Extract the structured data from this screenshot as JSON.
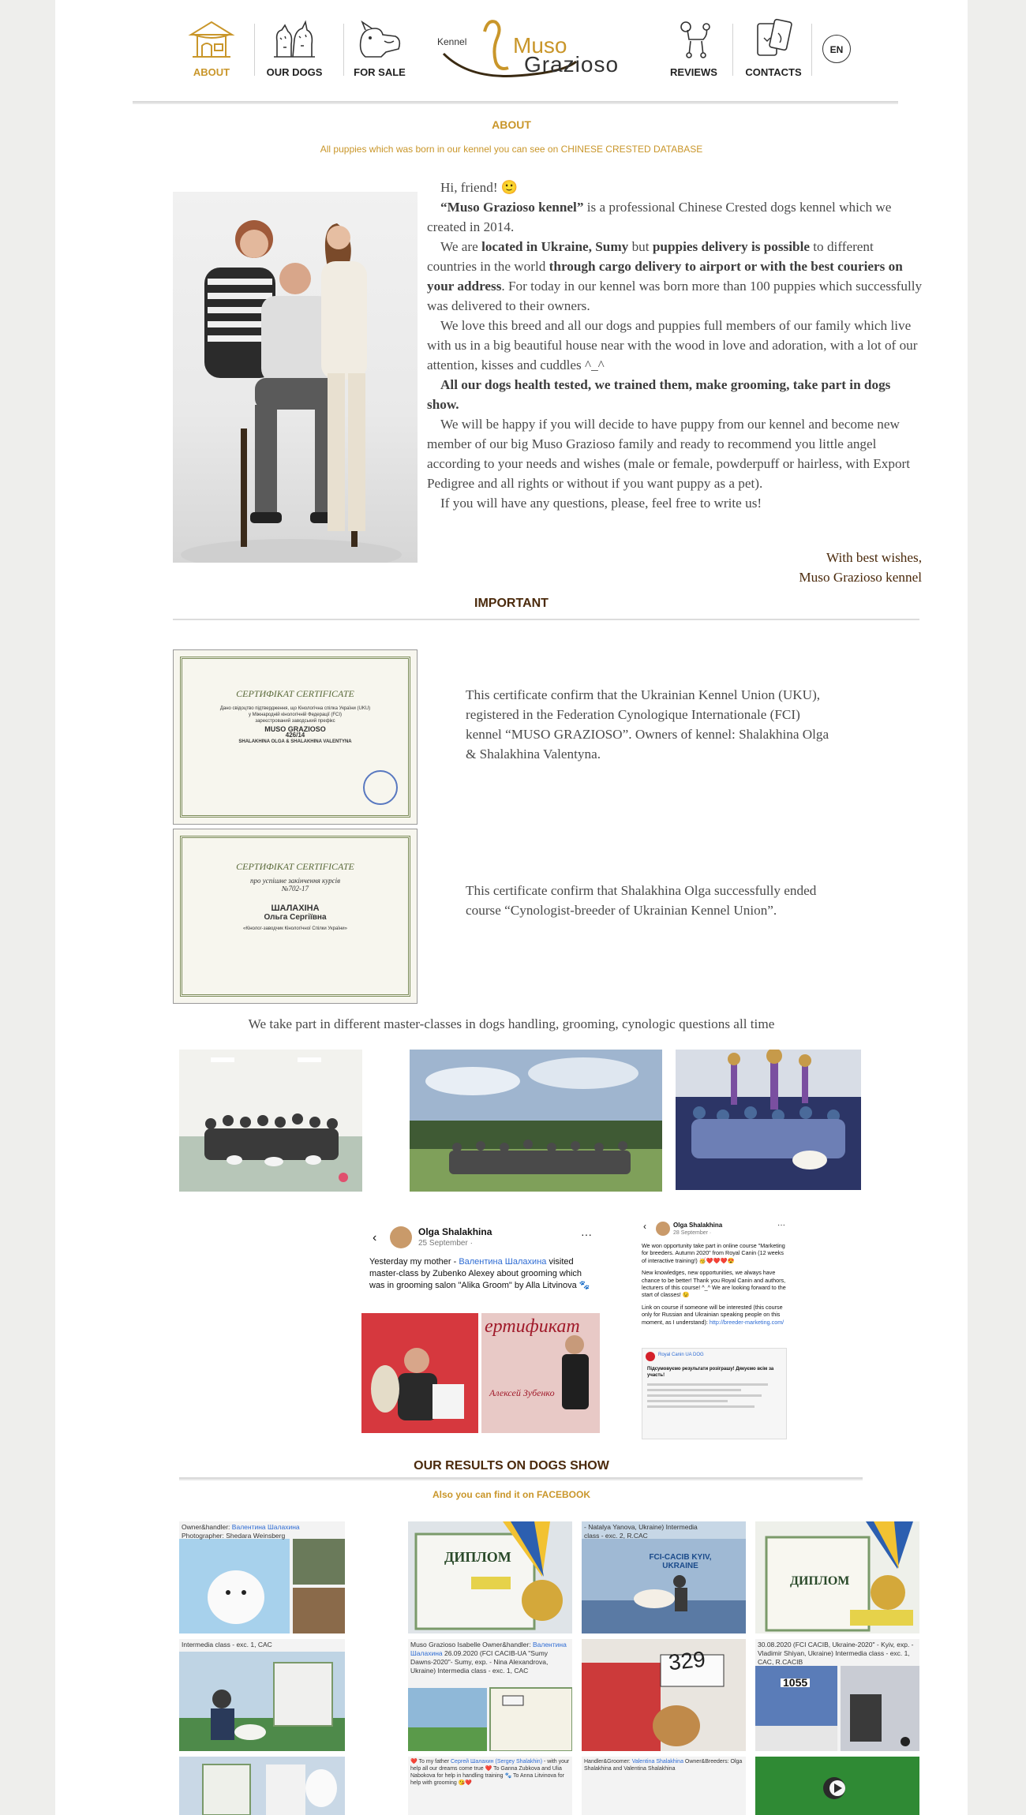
{
  "nav": {
    "about": "ABOUT",
    "our_dogs": "OUR DOGS",
    "for_sale": "FOR SALE",
    "reviews": "REVIEWS",
    "contacts": "CONTACTS",
    "lang": "EN"
  },
  "logo": {
    "kennel": "Kennel",
    "muso": "Muso",
    "grazioso": "Grazioso"
  },
  "about": {
    "title": "ABOUT",
    "subtitle": "All puppies which was born in our kennel you can see on CHINESE CRESTED DATABASE",
    "greeting": "Hi, friend! 🙂",
    "p1_bold": "“Muso Grazioso kennel”",
    "p1_rest": " is a professional Chinese Crested dogs kennel which we created in 2014.",
    "p2_a": "We are ",
    "p2_b": "located in Ukraine, Sumy",
    "p2_c": " but ",
    "p2_d": "puppies delivery is possible",
    "p2_e": " to different countries in the world ",
    "p2_f": "through cargo delivery to airport or with the best couriers on your address",
    "p2_g": ". For today in our kennel was born more than 100 puppies which successfully was delivered to their owners.",
    "p3": "We love this breed and all our dogs and puppies full members of our family which live with us in a big beautiful house near with the wood in love and adoration, with a lot of our attention, kisses and cuddles ^_^",
    "p4": "All our dogs health tested, we trained them, make grooming, take part in dogs show.",
    "p5": "We will be happy if you will decide to have puppy from our kennel and become new member of our big Muso Grazioso family and ready to recommend you little angel according to your needs and wishes (male or female, powderpuff or hairless, with Export Pedigree and all rights or without if you want puppy as a pet).",
    "p6": "If you will have any questions, please, feel free to write us!",
    "sign1": "With best wishes,",
    "sign2": "Muso Grazioso kennel"
  },
  "important": {
    "title": "IMPORTANT",
    "cert1_text": "This certificate confirm that the Ukrainian Kennel Union (UKU), registered in the Federation Cynologique Internationale (FCI) kennel “MUSO GRAZIOSO”. Owners of kennel: Shalakhina Olga & Shalakhina Valentyna.",
    "cert2_text": "This certificate confirm that Shalakhina Olga successfully ended course “Cynologist-breeder of Ukrainian Kennel Union”.",
    "cert1": {
      "title_ua": "СЕРТИФІКАТ CERTIFICATE",
      "line1": "Дано свідоцтво підтвердження, що Кінологічна спілка України (UKU)",
      "line2": "у Міжнародній кінологічній Федерації (FCI)",
      "line3": "зареєстрований заводський префікс",
      "name": "MUSO GRAZIOSO",
      "num": "426/14",
      "owners": "SHALAKHINA OLGA & SHALAKHINA VALENTYNA"
    },
    "cert2": {
      "title_ua": "СЕРТИФІКАТ CERTIFICATE",
      "line1": "про успішне закінчення курсів",
      "num": "№702-17",
      "name": "ШАЛАХІНА",
      "name2": "Ольга Сергіївна",
      "course": "«Кінолог-заводчик Кінологічної Спілки України»"
    },
    "masterclass_line": "We take part in different master-classes in dogs handling, grooming, cynologic questions all time"
  },
  "fb_posts": [
    {
      "name": "Olga Shalakhina",
      "date": "25 September · ",
      "text_a": "Yesterday my mother - ",
      "text_link": "Валентина Шалахина",
      "text_b": " visited master-class by Zubenko Alexey about grooming which was in grooming salon \"Alika Groom\" by Alla Litvinova 🐾",
      "img_word": "ертификат",
      "img_name": "Алексей Зубенко"
    },
    {
      "name": "Olga Shalakhina",
      "date": "28 September · ",
      "text1": "We won opportunity take part in online course \"Marketing for breeders. Autumn 2020\" from Royal Canin (12 weeks of interactive training!) 🥳❤️❤️❤️😍",
      "text2": "New knowledges, new opportunities, we always have chance to be better! Thank you Royal Canin and authors, lecturers of this course! ^_^ We are looking forward to the start of classes! 😉",
      "text3": "Link on course if someone will be interested (this course only for Russian and Ukrainian speaking people on this moment, as I understand): ",
      "text3_link": "http://breeder-marketing.com/",
      "rc_name": "Royal Canin UA DOG",
      "rc_text": "Підсумовуємо результати розіграшу! Дякуємо всім за участь!"
    }
  ],
  "results": {
    "title": "OUR RESULTS ON DOGS SHOW",
    "subtitle": "Also you can find it on FACEBOOK",
    "tiles": [
      {
        "cap_a": "Owner&handler: ",
        "cap_link": "Валентина Шалахина",
        "cap_b": " Photographer: Shedara Weinsberg"
      },
      {
        "cap_a": "",
        "cap_link": "",
        "cap_b": "ДИПЛОМ"
      },
      {
        "cap_a": "- Natalya Yanova, Ukraine) Intermedia class - exc. 2, R.CAC",
        "cap_link": "",
        "cap_b": "FCI-CACIB KYIV, UKRAINE"
      },
      {
        "cap_a": "",
        "cap_link": "",
        "cap_b": "ДИПЛОМ"
      },
      {
        "cap_a": "Intermedia class - exc. 1, CAC",
        "cap_link": "",
        "cap_b": ""
      },
      {
        "cap_a": "Muso Grazioso Isabelle Owner&handler: ",
        "cap_link": "Валентина Шалахина",
        "cap_b": " 26.09.2020 (FCI CACIB-UA \"Sumy Dawns-2020\"- Sumy, exp. - Nina Alexandrova, Ukraine) Intermedia class - exc. 1, CAC"
      },
      {
        "cap_a": "",
        "cap_link": "",
        "cap_b": "329"
      },
      {
        "cap_a": "30.08.2020 (FCI CACIB, Ukraine-2020\" - Kyiv, exp. - Vladimir Shiyan, Ukraine) Intermedia class - exc. 1, CAC, R.CACIB",
        "cap_link": "",
        "cap_b": "1055"
      },
      {
        "cap_a": "",
        "cap_link": "",
        "cap_b": ""
      },
      {
        "cap_a": "❤️ To my father ",
        "cap_link": "Сергей Шалахин (Sergey Shalakhin)",
        "cap_b": " - with your help all our dreams come true ❤️ To Ganna Zubkova and Ulia Nabokova for help in handling training 🐾 To Anna Litvinova for help with grooming 😘❤️"
      },
      {
        "cap_a": "Handler&Groomer: ",
        "cap_link": "Valentina Shalakhina",
        "cap_b": " Owner&Breeders: Olga Shalakhina and Valentina Shalakhina"
      },
      {
        "cap_a": "",
        "cap_link": "",
        "cap_b": ""
      }
    ]
  },
  "colors": {
    "accent_gold": "#c9962a",
    "heading_brown": "#4b2a0c",
    "body_text": "#4a4a4a",
    "link_blue": "#2d6bd3"
  }
}
